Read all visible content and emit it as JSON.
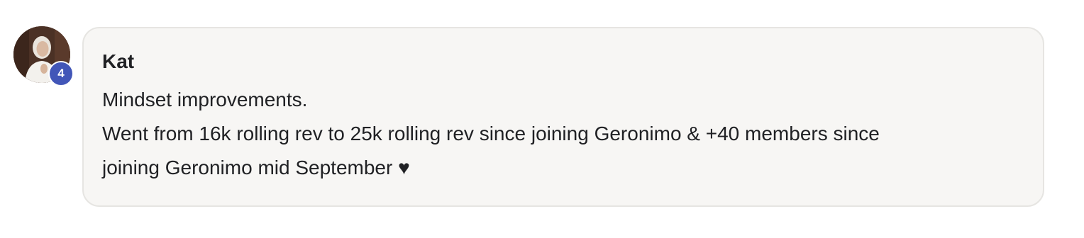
{
  "comment": {
    "author": {
      "name": "Kat",
      "level": "4",
      "avatar_icon": "profile-photo"
    },
    "body_lines": [
      "Mindset improvements.",
      "Went from 16k rolling rev to 25k rolling rev since joining Geronimo & +40 members since",
      "joining Geronimo mid September ♥"
    ]
  },
  "colors": {
    "bubble_background": "#f7f6f4",
    "bubble_border": "#e6e5e2",
    "badge": "#4256b8",
    "text": "#202124"
  }
}
